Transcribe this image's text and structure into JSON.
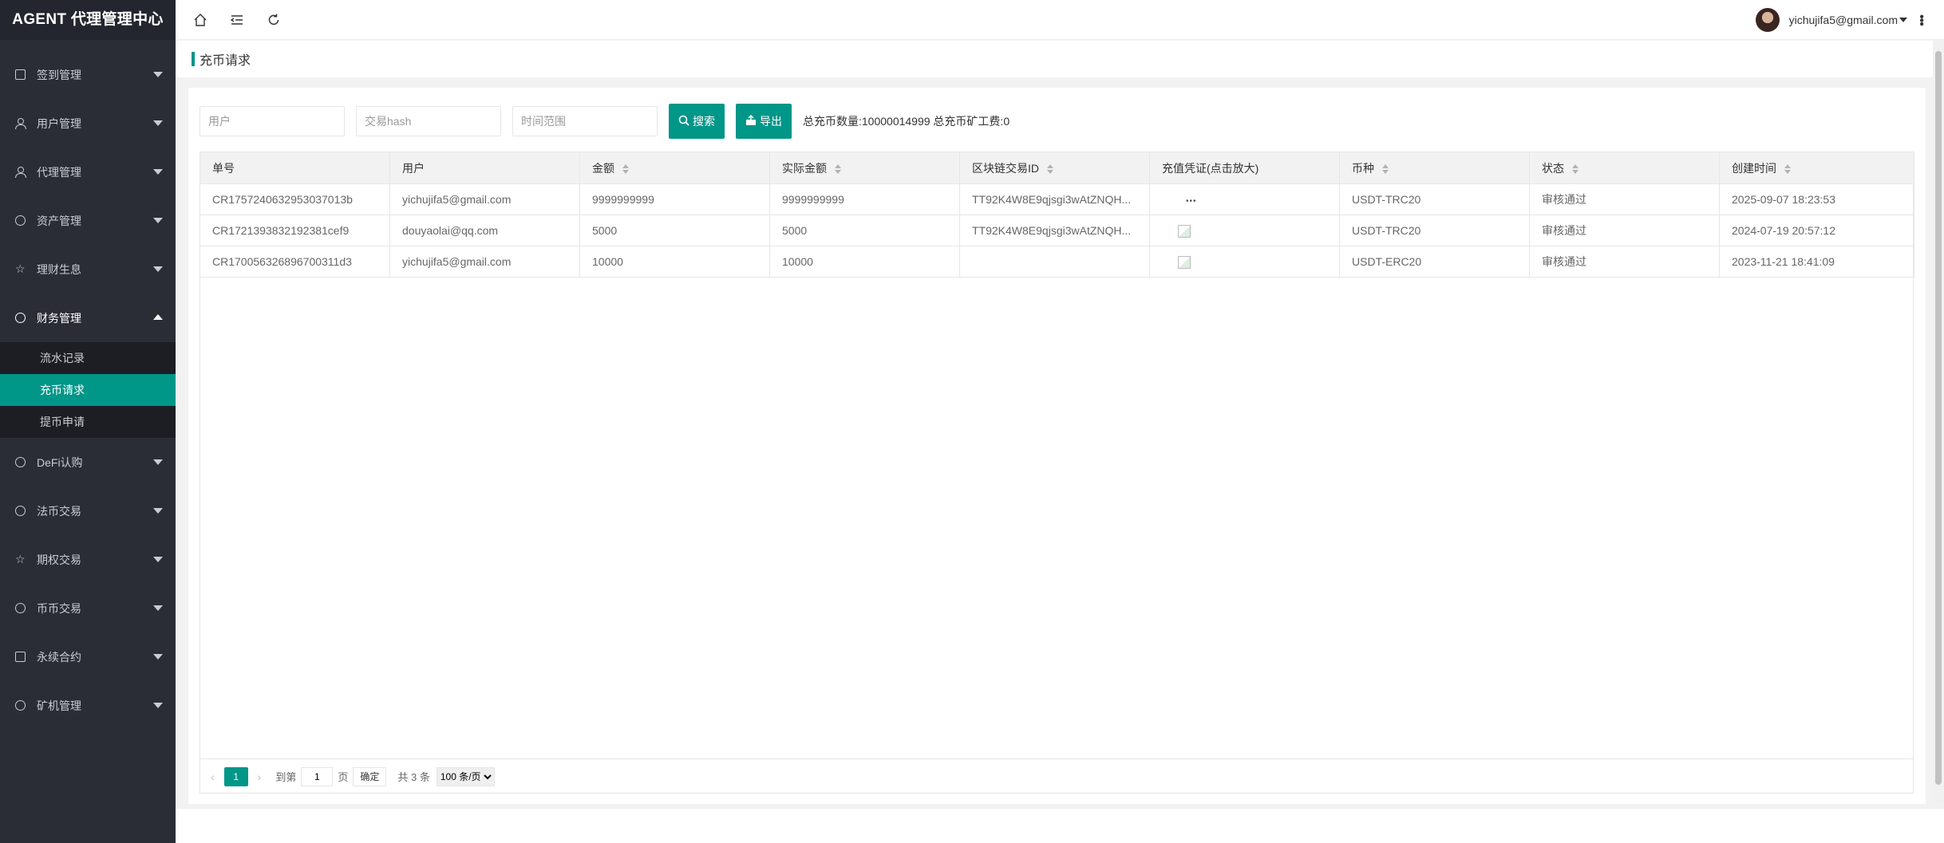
{
  "app": {
    "title": "AGENT 代理管理中心"
  },
  "sidebar": {
    "items": [
      {
        "label": "签到管理",
        "icon": "doc-icon"
      },
      {
        "label": "用户管理",
        "icon": "user-icon"
      },
      {
        "label": "代理管理",
        "icon": "user-icon"
      },
      {
        "label": "资产管理",
        "icon": "dollar-circle-icon"
      },
      {
        "label": "理财生息",
        "icon": "star-icon"
      },
      {
        "label": "财务管理",
        "icon": "yen-circle-icon",
        "open": true,
        "children": [
          {
            "label": "流水记录"
          },
          {
            "label": "充币请求",
            "active": true
          },
          {
            "label": "提币申请"
          }
        ]
      },
      {
        "label": "DeFi认购",
        "icon": "clock-icon"
      },
      {
        "label": "法币交易",
        "icon": "hand-icon"
      },
      {
        "label": "期权交易",
        "icon": "star-icon"
      },
      {
        "label": "币币交易",
        "icon": "swap-icon"
      },
      {
        "label": "永续合约",
        "icon": "doc-icon"
      },
      {
        "label": "矿机管理",
        "icon": "mining-icon"
      }
    ]
  },
  "header": {
    "buttons": [
      "home-icon",
      "menu-fold-icon",
      "refresh-icon"
    ],
    "user_email": "yichujifa5@gmail.com"
  },
  "breadcrumb": {
    "title": "充币请求"
  },
  "filters": {
    "user_placeholder": "用户",
    "hash_placeholder": "交易hash",
    "time_placeholder": "时间范围",
    "search_label": "搜索",
    "export_label": "导出",
    "summary": "总充币数量:10000014999 总充币矿工费:0"
  },
  "table": {
    "columns": [
      "单号",
      "用户",
      "金额",
      "实际金额",
      "区块链交易ID",
      "充值凭证(点击放大)",
      "币种",
      "状态",
      "创建时间"
    ],
    "rows": [
      {
        "order_no": "CR1757240632953037013b",
        "user": "yichujifa5@gmail.com",
        "amount": "9999999999",
        "actual": "9999999999",
        "txid": "TT92K4W8E9qjsgi3wAtZNQH...",
        "proof": "•••",
        "coin": "USDT-TRC20",
        "status": "审核通过",
        "created": "2025-09-07 18:23:53"
      },
      {
        "order_no": "CR1721393832192381cef9",
        "user": "douyaolai@qq.com",
        "amount": "5000",
        "actual": "5000",
        "txid": "TT92K4W8E9qjsgi3wAtZNQH...",
        "proof": "",
        "coin": "USDT-TRC20",
        "status": "审核通过",
        "created": "2024-07-19 20:57:12"
      },
      {
        "order_no": "CR170056326896700311d3",
        "user": "yichujifa5@gmail.com",
        "amount": "10000",
        "actual": "10000",
        "txid": "",
        "proof": "",
        "coin": "USDT-ERC20",
        "status": "审核通过",
        "created": "2023-11-21 18:41:09"
      }
    ]
  },
  "pager": {
    "current": "1",
    "goto_prefix": "到第",
    "goto_value": "1",
    "goto_suffix": "页",
    "confirm": "确定",
    "total": "共 3 条",
    "page_size": "100 条/页"
  },
  "colors": {
    "accent": "#009688",
    "sidebar_bg": "#2a2d36"
  }
}
